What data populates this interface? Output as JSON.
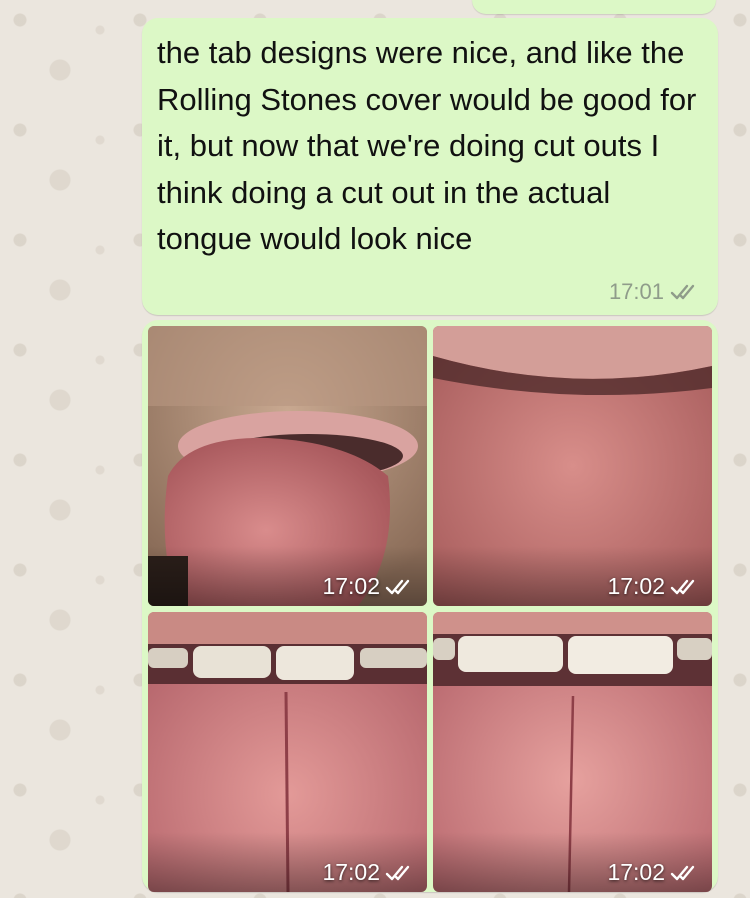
{
  "chat": {
    "outgoing_text_message": {
      "text": "the tab designs were nice, and like the Rolling Stones cover would be good for it, but now that we're doing cut outs I think doing a cut out in the actual tongue would look nice",
      "time": "17:01",
      "status_icon": "double-check-icon"
    },
    "photo_messages": [
      {
        "time": "17:02",
        "status_icon": "double-check-icon"
      },
      {
        "time": "17:02",
        "status_icon": "double-check-icon"
      },
      {
        "time": "17:02",
        "status_icon": "double-check-icon"
      },
      {
        "time": "17:02",
        "status_icon": "double-check-icon"
      }
    ]
  },
  "colors": {
    "outgoing_bubble": "#dcf8c6",
    "wallpaper": "#ece5dd",
    "meta_text": "#8f9c8a"
  }
}
